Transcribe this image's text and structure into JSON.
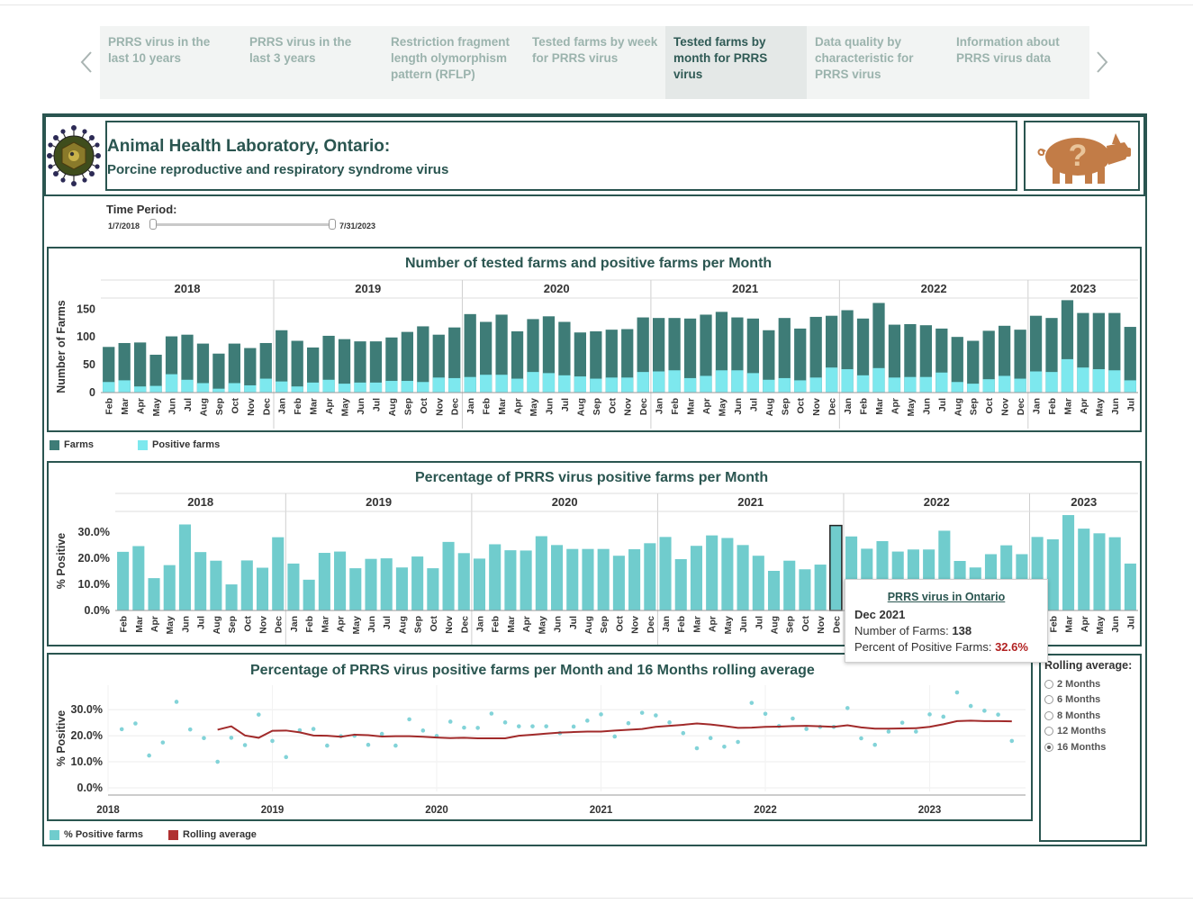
{
  "tabs": [
    {
      "label": "PRRS virus in the last 10 years",
      "active": false
    },
    {
      "label": "PRRS virus in the last 3 years",
      "active": false
    },
    {
      "label": "Restriction fragment length olymorphism pattern (RFLP)",
      "active": false
    },
    {
      "label": "Tested farms by week for PRRS virus",
      "active": false
    },
    {
      "label": "Tested farms by month for PRRS virus",
      "active": true
    },
    {
      "label": "Data quality by characteristic for PRRS virus",
      "active": false
    },
    {
      "label": "Information about PRRS virus data",
      "active": false
    }
  ],
  "header": {
    "title": "Animal Health Laboratory, Ontario:",
    "subtitle": "Porcine reproductive and respiratory syndrome virus",
    "pig_icon_symbol": "?"
  },
  "time_period": {
    "label": "Time Period:",
    "start": "1/7/2018",
    "end": "7/31/2023"
  },
  "colors": {
    "frame": "#2a5550",
    "farms": "#3e7c77",
    "positive": "#7de8ee",
    "pct_bar": "#70cccd",
    "rolling": "#a12a2a",
    "dots": "#82d3d8"
  },
  "chart_data": [
    {
      "type": "bar",
      "title": "Number of tested farms and positive farms per Month",
      "ylabel": "Number of Farms",
      "ylim": [
        0,
        165
      ],
      "yticks": [
        "150",
        "100",
        "50",
        "0"
      ],
      "years": [
        {
          "label": "2018",
          "months": 11
        },
        {
          "label": "2019",
          "months": 12
        },
        {
          "label": "2020",
          "months": 12
        },
        {
          "label": "2021",
          "months": 12
        },
        {
          "label": "2022",
          "months": 12
        },
        {
          "label": "2023",
          "months": 7
        }
      ],
      "categories": [
        "Feb",
        "Mar",
        "Apr",
        "May",
        "Jun",
        "Jul",
        "Aug",
        "Sep",
        "Oct",
        "Nov",
        "Dec",
        "Jan",
        "Feb",
        "Mar",
        "Apr",
        "May",
        "Jun",
        "Jul",
        "Aug",
        "Sep",
        "Oct",
        "Nov",
        "Dec",
        "Jan",
        "Feb",
        "Mar",
        "Apr",
        "May",
        "Jun",
        "Jul",
        "Aug",
        "Sep",
        "Oct",
        "Nov",
        "Dec",
        "Jan",
        "Feb",
        "Mar",
        "Apr",
        "May",
        "Jun",
        "Jul",
        "Aug",
        "Sep",
        "Oct",
        "Nov",
        "Dec",
        "Jan",
        "Feb",
        "Mar",
        "Apr",
        "May",
        "Jun",
        "Jul",
        "Aug",
        "Sep",
        "Oct",
        "Nov",
        "Dec",
        "Jan",
        "Feb",
        "Mar",
        "Apr",
        "May",
        "Jun",
        "Jul"
      ],
      "series": [
        {
          "name": "Farms",
          "values": [
            82,
            89,
            90,
            68,
            101,
            104,
            88,
            70,
            88,
            80,
            89,
            112,
            93,
            81,
            102,
            96,
            92,
            92,
            99,
            109,
            119,
            104,
            117,
            141,
            127,
            140,
            110,
            132,
            137,
            127,
            108,
            110,
            113,
            114,
            135,
            134,
            134,
            133,
            140,
            145,
            135,
            133,
            112,
            134,
            115,
            136,
            138,
            148,
            133,
            161,
            122,
            123,
            121,
            115,
            100,
            93,
            111,
            120,
            113,
            138,
            134,
            166,
            143,
            143,
            143,
            118
          ]
        },
        {
          "name": "Positive farms",
          "values": [
            19,
            22,
            11,
            12,
            33,
            23,
            17,
            7,
            17,
            13,
            25,
            20,
            11,
            18,
            23,
            16,
            18,
            18,
            21,
            21,
            19,
            27,
            26,
            28,
            32,
            32,
            25,
            37,
            35,
            31,
            29,
            25,
            27,
            27,
            37,
            38,
            40,
            26,
            30,
            40,
            40,
            35,
            23,
            26,
            22,
            27,
            45,
            42,
            31,
            44,
            27,
            28,
            28,
            36,
            19,
            16,
            24,
            30,
            25,
            38,
            37,
            60,
            45,
            42,
            40,
            22
          ]
        }
      ],
      "legend": [
        "Farms",
        "Positive farms"
      ]
    },
    {
      "type": "bar",
      "title": "Percentage of PRRS virus positive farms per Month",
      "ylabel": "% Positive",
      "ylim": [
        0,
        38
      ],
      "yticks": [
        "30.0%",
        "20.0%",
        "10.0%",
        "0.0%"
      ],
      "years": [
        {
          "label": "2018",
          "months": 11
        },
        {
          "label": "2019",
          "months": 12
        },
        {
          "label": "2020",
          "months": 12
        },
        {
          "label": "2021",
          "months": 12
        },
        {
          "label": "2022",
          "months": 12
        },
        {
          "label": "2023",
          "months": 7
        }
      ],
      "values": [
        22.5,
        24.7,
        12.4,
        17.4,
        33.0,
        22.4,
        19.1,
        10.0,
        19.2,
        16.4,
        28.1,
        18.0,
        11.8,
        22.1,
        22.6,
        16.2,
        19.8,
        20.0,
        16.5,
        20.7,
        16.2,
        26.3,
        22.0,
        19.9,
        25.4,
        23.1,
        23.0,
        28.5,
        25.1,
        23.6,
        23.6,
        23.6,
        21.0,
        23.5,
        25.8,
        28.2,
        19.7,
        24.8,
        28.8,
        27.8,
        25.1,
        21.0,
        15.2,
        19.1,
        15.8,
        17.6,
        32.6,
        28.4,
        23.7,
        26.6,
        22.6,
        23.4,
        23.4,
        30.6,
        19.0,
        16.5,
        21.6,
        25.0,
        21.6,
        28.2,
        27.3,
        36.6,
        31.4,
        29.6,
        28.1,
        18.0
      ],
      "highlight_index": 46
    },
    {
      "type": "line",
      "title": "Percentage of PRRS virus positive farms per Month and 16 Months rolling average",
      "ylabel": "% Positive",
      "ylim": [
        0,
        38
      ],
      "yticks": [
        "30.0%",
        "20.0%",
        "10.0%",
        "0.0%"
      ],
      "xticks": [
        "2018",
        "2019",
        "2020",
        "2021",
        "2022",
        "2023"
      ],
      "x_start": "2018-02",
      "series": [
        {
          "name": "% Positive farms",
          "values": [
            22.5,
            24.7,
            12.4,
            17.4,
            33.0,
            22.4,
            19.1,
            10.0,
            19.2,
            16.4,
            28.1,
            18.0,
            11.8,
            22.1,
            22.6,
            16.2,
            19.8,
            20.0,
            16.5,
            20.7,
            16.2,
            26.3,
            22.0,
            19.9,
            25.4,
            23.1,
            23.0,
            28.5,
            25.1,
            23.6,
            23.6,
            23.6,
            21.0,
            23.5,
            25.8,
            28.2,
            19.7,
            24.8,
            28.8,
            27.8,
            25.1,
            21.0,
            15.2,
            19.1,
            15.8,
            17.6,
            32.6,
            28.4,
            23.7,
            26.6,
            22.6,
            23.4,
            23.4,
            30.6,
            19.0,
            16.5,
            21.6,
            25.0,
            21.6,
            28.2,
            27.3,
            36.6,
            31.4,
            29.6,
            28.1,
            18.0
          ]
        },
        {
          "name": "Rolling average",
          "values": [
            null,
            null,
            null,
            null,
            null,
            null,
            null,
            22.3,
            23.6,
            20.1,
            19.2,
            21.9,
            22.0,
            21.3,
            20.1,
            20.0,
            19.6,
            20.4,
            20.2,
            19.7,
            19.8,
            19.8,
            19.6,
            19.3,
            19.1,
            19.2,
            19.0,
            19.0,
            19.0,
            20.0,
            20.4,
            20.8,
            21.2,
            21.4,
            21.6,
            21.6,
            22.0,
            22.3,
            22.6,
            23.4,
            23.8,
            24.2,
            24.7,
            24.3,
            23.7,
            23.0,
            23.1,
            23.4,
            23.5,
            23.7,
            23.8,
            23.6,
            23.4,
            24.0,
            23.2,
            22.7,
            22.7,
            22.8,
            22.9,
            23.4,
            24.4,
            25.6,
            25.8,
            25.6,
            25.6,
            25.5
          ]
        }
      ],
      "legend": [
        "% Positive farms",
        "Rolling average"
      ]
    }
  ],
  "tooltip": {
    "title": "PRRS virus in Ontario",
    "month": "Dec 2021",
    "farms_label": "Number of Farms:",
    "farms_value": "138",
    "pct_label": "Percent of Positive Farms:",
    "pct_value": "32.6%"
  },
  "rolling_average": {
    "title": "Rolling average:",
    "options": [
      "2 Months",
      "6 Months",
      "8 Months",
      "12 Months",
      "16 Months"
    ],
    "selected": "16 Months"
  }
}
